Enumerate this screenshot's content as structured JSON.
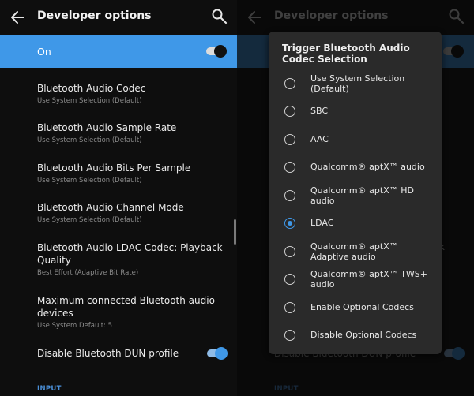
{
  "app": {
    "title": "Developer options"
  },
  "master_switch": {
    "label": "On",
    "state": true
  },
  "settings": [
    {
      "title": "Bluetooth Audio Codec",
      "summary": "Use System Selection (Default)"
    },
    {
      "title": "Bluetooth Audio Sample Rate",
      "summary": "Use System Selection (Default)"
    },
    {
      "title": "Bluetooth Audio Bits Per Sample",
      "summary": "Use System Selection (Default)"
    },
    {
      "title": "Bluetooth Audio Channel Mode",
      "summary": "Use System Selection (Default)"
    },
    {
      "title": "Bluetooth Audio LDAC Codec: Playback Quality",
      "summary": "Best Effort (Adaptive Bit Rate)"
    },
    {
      "title": "Maximum connected Bluetooth audio devices",
      "summary": "Use System Default: 5"
    }
  ],
  "dun": {
    "label": "Disable Bluetooth DUN profile",
    "partial_label": "Disable Bluetooth DUN profile",
    "state": true
  },
  "section_header": "INPUT",
  "peek_text": "k",
  "dialog": {
    "title": "Trigger Bluetooth Audio Codec Selection",
    "selected_index": 5,
    "options": [
      "Use System Selection (Default)",
      "SBC",
      "AAC",
      "Qualcomm® aptX™ audio",
      "Qualcomm® aptX™ HD audio",
      "LDAC",
      "Qualcomm® aptX™ Adaptive audio",
      "Qualcomm® aptX™ TWS+ audio",
      "Enable Optional Codecs",
      "Disable Optional Codecs"
    ]
  },
  "colors": {
    "accent": "#3f98e8",
    "background": "#0e0e0e",
    "dialog": "#2a2a2a"
  }
}
